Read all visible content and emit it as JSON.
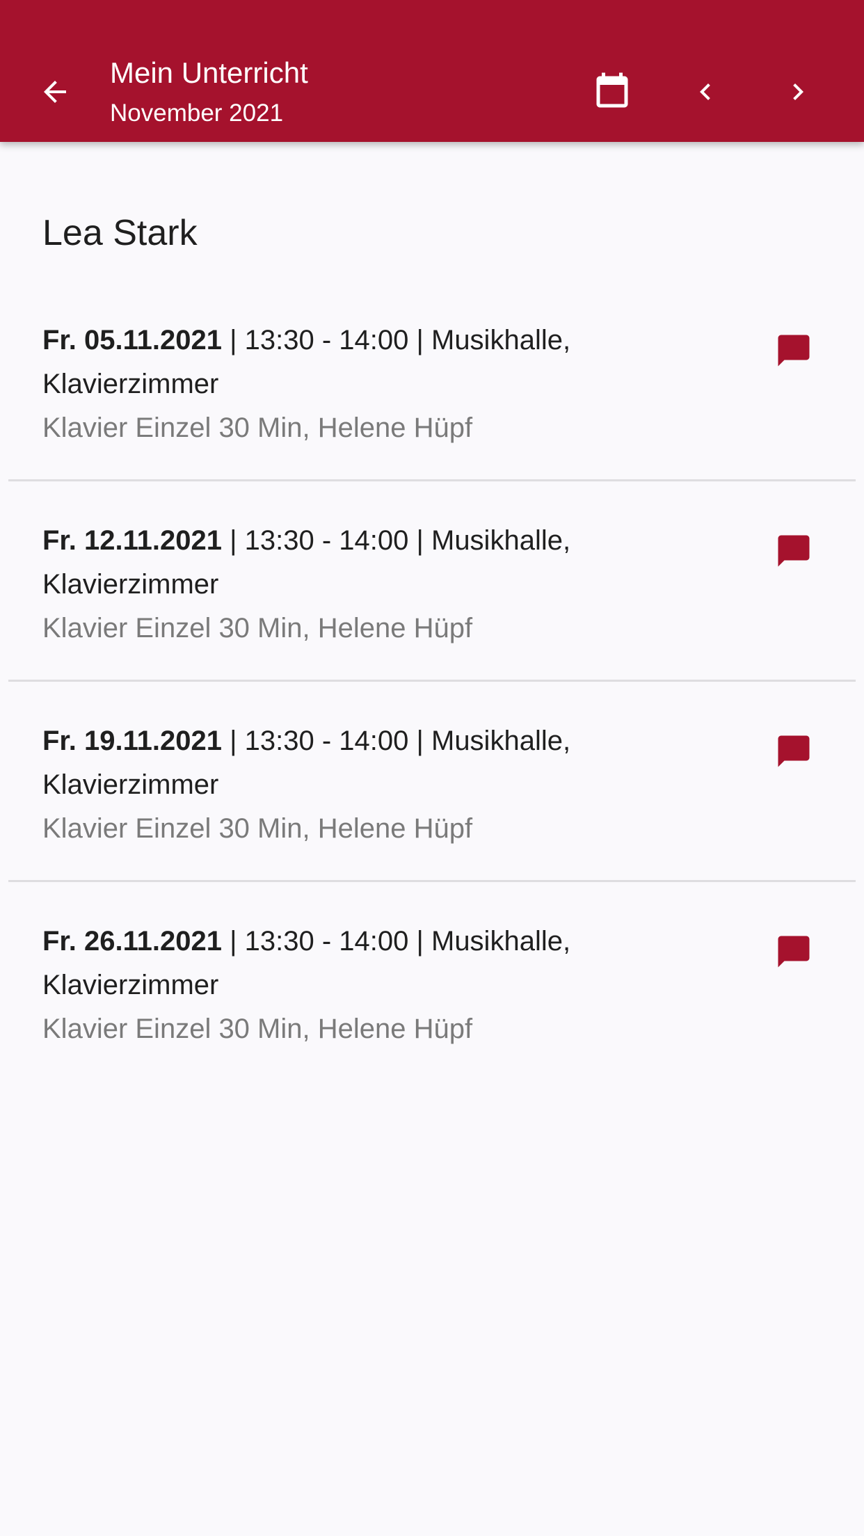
{
  "appbar": {
    "title": "Mein Unterricht",
    "subtitle": "November 2021",
    "background_color": "#a5122d",
    "icons": {
      "back": "arrow-left-icon",
      "calendar": "calendar-icon",
      "previous": "chevron-left-icon",
      "next": "chevron-right-icon"
    }
  },
  "student": {
    "name": "Lea Stark"
  },
  "lessons": [
    {
      "date": "Fr. 05.11.2021",
      "time_location": " | 13:30 - 14:00 | Musikhalle,",
      "room": "Klavierzimmer",
      "detail": "Klavier Einzel 30 Min, Helene Hüpf"
    },
    {
      "date": "Fr. 12.11.2021",
      "time_location": " | 13:30 - 14:00 | Musikhalle,",
      "room": "Klavierzimmer",
      "detail": "Klavier Einzel 30 Min, Helene Hüpf"
    },
    {
      "date": "Fr. 19.11.2021",
      "time_location": " | 13:30 - 14:00 | Musikhalle,",
      "room": "Klavierzimmer",
      "detail": "Klavier Einzel 30 Min, Helene Hüpf"
    },
    {
      "date": "Fr. 26.11.2021",
      "time_location": " | 13:30 - 14:00 | Musikhalle,",
      "room": "Klavierzimmer",
      "detail": "Klavier Einzel 30 Min, Helene Hüpf"
    }
  ],
  "comment_icon": "comment-icon",
  "accent_color": "#a5122d"
}
